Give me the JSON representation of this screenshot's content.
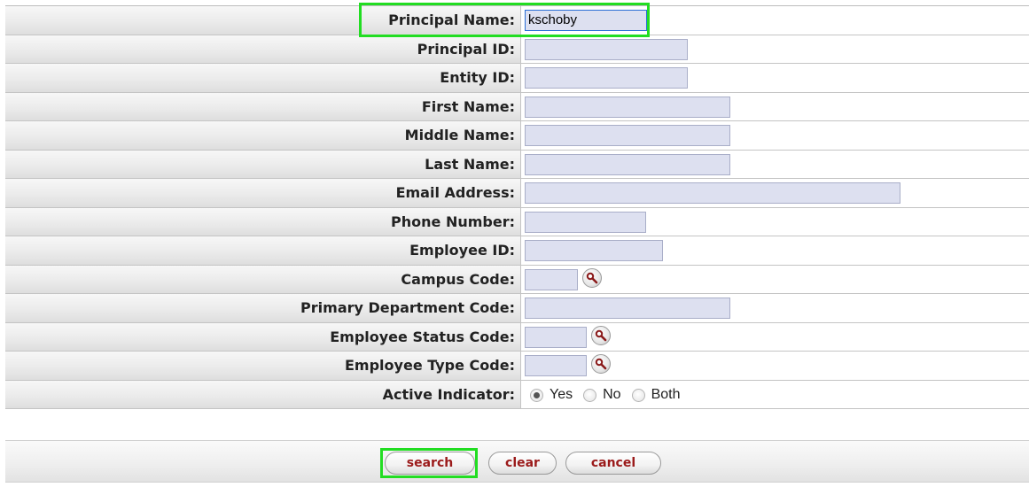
{
  "form": {
    "fields": [
      {
        "label": "Principal Name:",
        "value": "kschoby"
      },
      {
        "label": "Principal ID:",
        "value": ""
      },
      {
        "label": "Entity ID:",
        "value": ""
      },
      {
        "label": "First Name:",
        "value": ""
      },
      {
        "label": "Middle Name:",
        "value": ""
      },
      {
        "label": "Last Name:",
        "value": ""
      },
      {
        "label": "Email Address:",
        "value": ""
      },
      {
        "label": "Phone Number:",
        "value": ""
      },
      {
        "label": "Employee ID:",
        "value": ""
      },
      {
        "label": "Campus Code:",
        "value": "",
        "lookup": "magnifier-icon"
      },
      {
        "label": "Primary Department Code:",
        "value": ""
      },
      {
        "label": "Employee Status Code:",
        "value": "",
        "lookup": "magnifier-icon"
      },
      {
        "label": "Employee Type Code:",
        "value": "",
        "lookup": "magnifier-icon"
      }
    ],
    "active_indicator": {
      "label": "Active Indicator:",
      "options": [
        "Yes",
        "No",
        "Both"
      ],
      "selected": "Yes"
    }
  },
  "buttons": {
    "search": "search",
    "clear": "clear",
    "cancel": "cancel"
  },
  "colors": {
    "input_bg": "#dde0f0",
    "highlight": "#22dd22",
    "button_text": "#9b1b1b"
  }
}
